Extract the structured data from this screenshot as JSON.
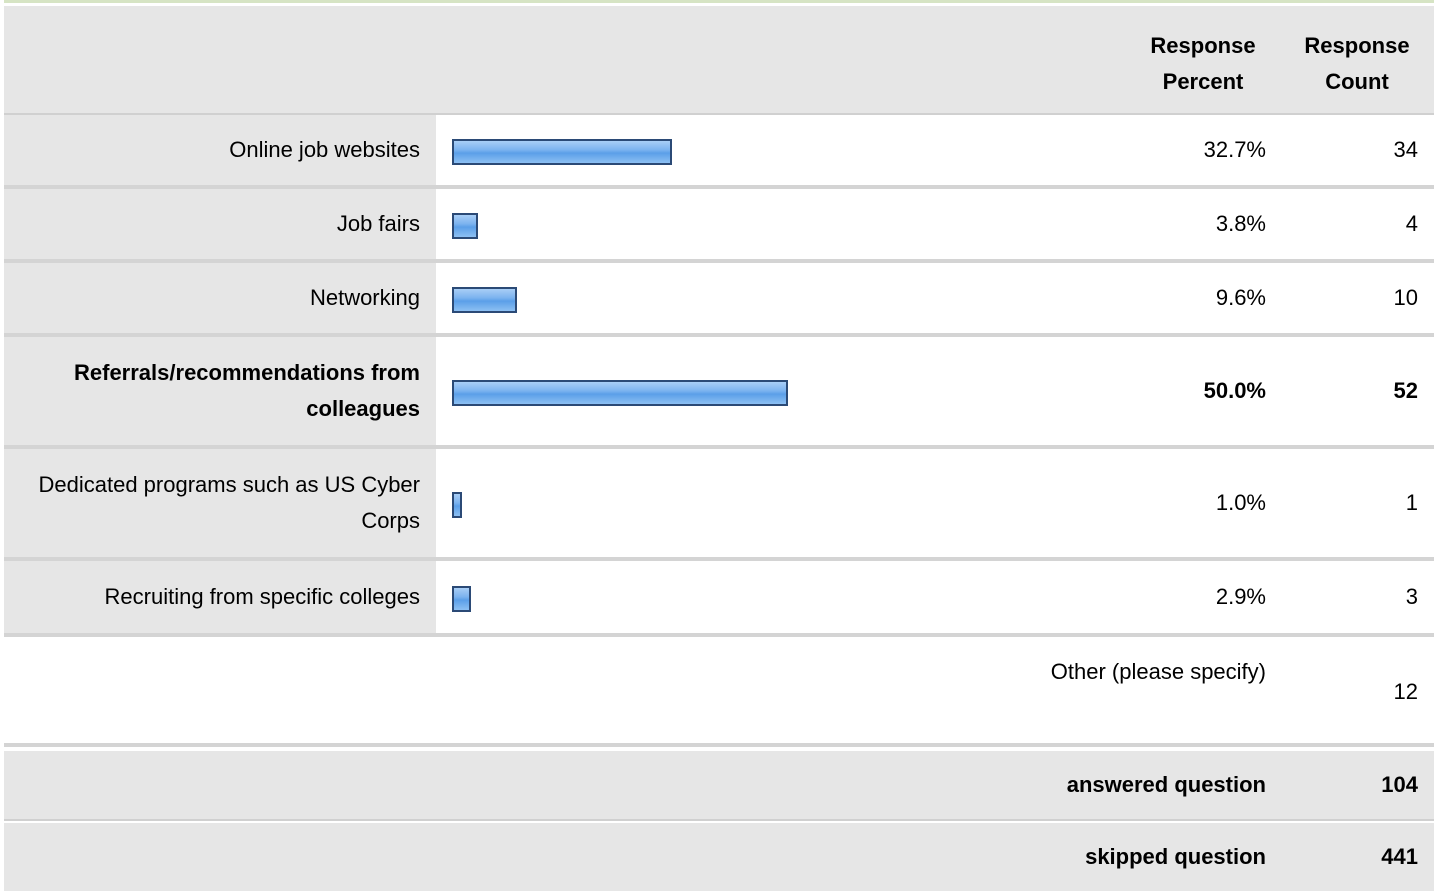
{
  "header": {
    "percent_line1": "Response",
    "percent_line2": "Percent",
    "count_line1": "Response",
    "count_line2": "Count"
  },
  "chart_data": {
    "type": "bar",
    "orientation": "horizontal",
    "categories": [
      "Online job websites",
      "Job fairs",
      "Networking",
      "Referrals/recommendations from colleagues",
      "Dedicated programs such as US Cyber Corps",
      "Recruiting from specific colleges"
    ],
    "values": [
      32.7,
      3.8,
      9.6,
      50.0,
      1.0,
      2.9
    ],
    "percent_labels": [
      "32.7%",
      "3.8%",
      "9.6%",
      "50.0%",
      "1.0%",
      "2.9%"
    ],
    "counts": [
      "34",
      "4",
      "10",
      "52",
      "1",
      "3"
    ],
    "highlight_index": 3,
    "xlim": [
      0,
      100
    ],
    "bar_colors": [
      "#a9cef6",
      "#5b9fe8"
    ],
    "bar_border_color": "#2b4a76"
  },
  "other": {
    "label": "Other (please specify)",
    "count": "12"
  },
  "summary": {
    "answered_label": "answered question",
    "answered_value": "104",
    "skipped_label": "skipped question",
    "skipped_value": "441"
  }
}
